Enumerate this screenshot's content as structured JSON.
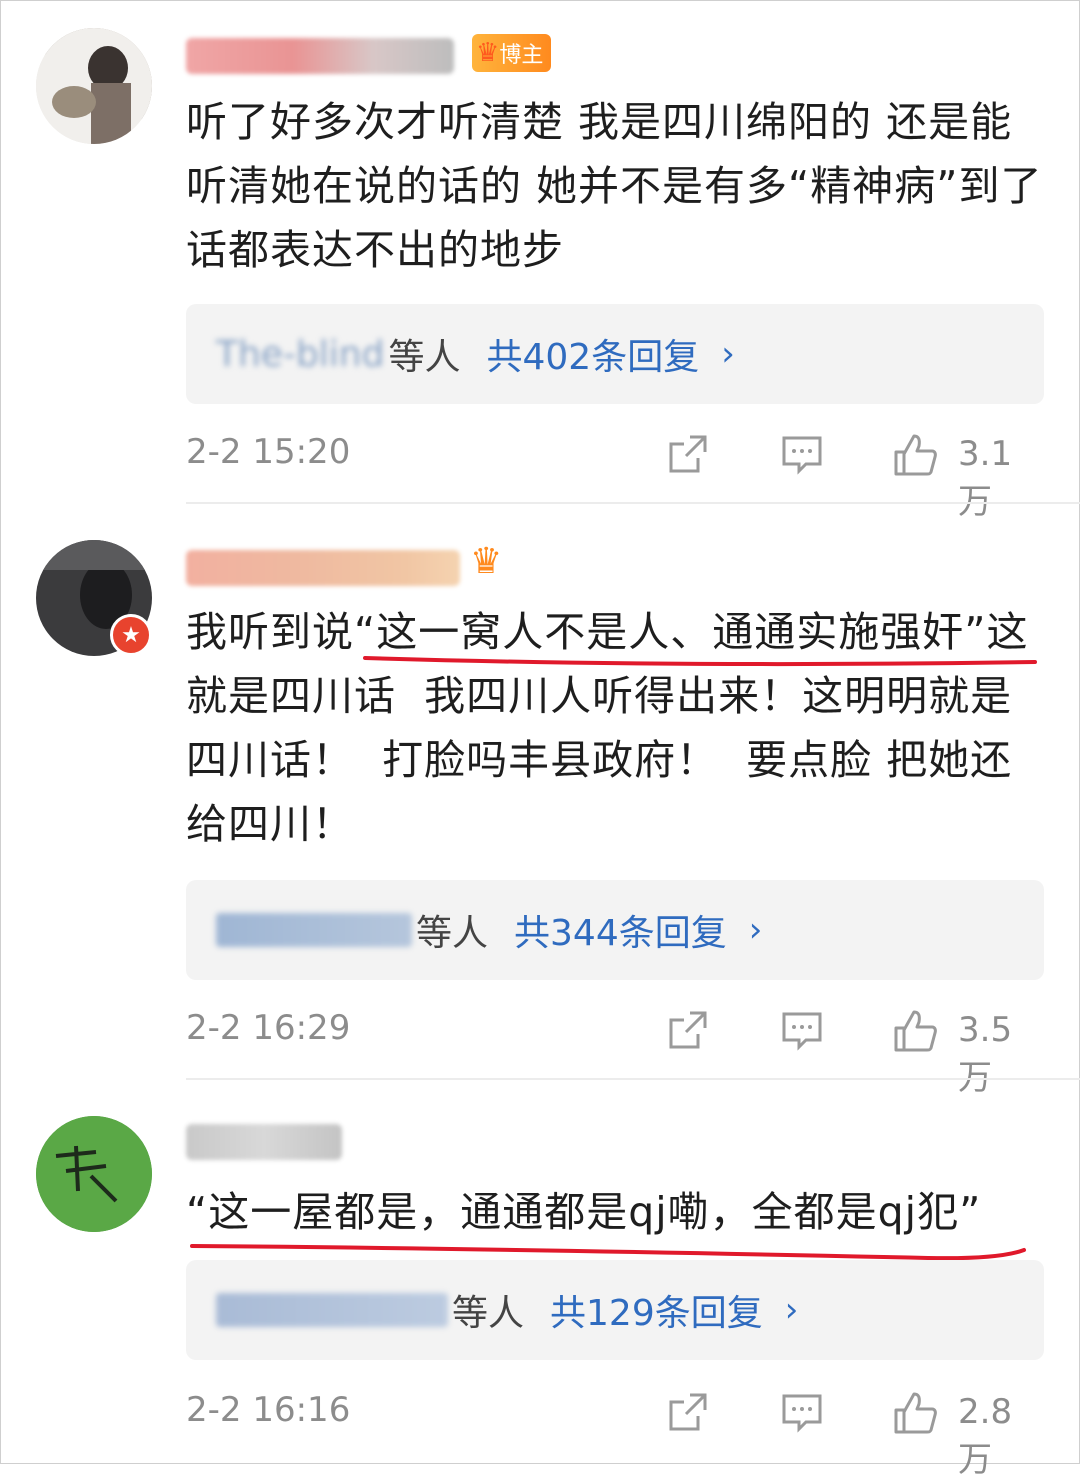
{
  "comments": [
    {
      "badge_label": "博主",
      "text": "听了好多次才听清楚 我是四川绵阳的 还是能听清她在说的话的 她并不是有多“精神病”到了话都表达不出的地步",
      "replies_suffix": "等人",
      "replies_count": "共402条回复",
      "timestamp": "2-2 15:20",
      "likes": "3.1万",
      "blurred_name_hint": "The-blind"
    },
    {
      "badge_label": "",
      "text": "我听到说“这一窝人不是人、通通实施强奸”这就是四川话  我四川人听得出来！这明明就是四川话！  打脸吗丰县政府！  要点脸 把她还给四川！",
      "replies_suffix": "等人",
      "replies_count": "共344条回复",
      "timestamp": "2-2 16:29",
      "likes": "3.5万",
      "blurred_name_hint": ""
    },
    {
      "badge_label": "",
      "text": "“这一屋都是，通通都是qj嘞，全都是qj犯”",
      "replies_suffix": "等人",
      "replies_count": "共129条回复",
      "timestamp": "2-2 16:16",
      "likes": "2.8万",
      "blurred_name_hint": ""
    }
  ],
  "icons": {
    "share": "share-icon",
    "comment": "comment-icon",
    "like": "like-icon",
    "chevron": "chevron-right-icon"
  },
  "colors": {
    "link": "#2f6bbf",
    "annotation": "#e0192b",
    "badge": "#ff8a1e"
  }
}
